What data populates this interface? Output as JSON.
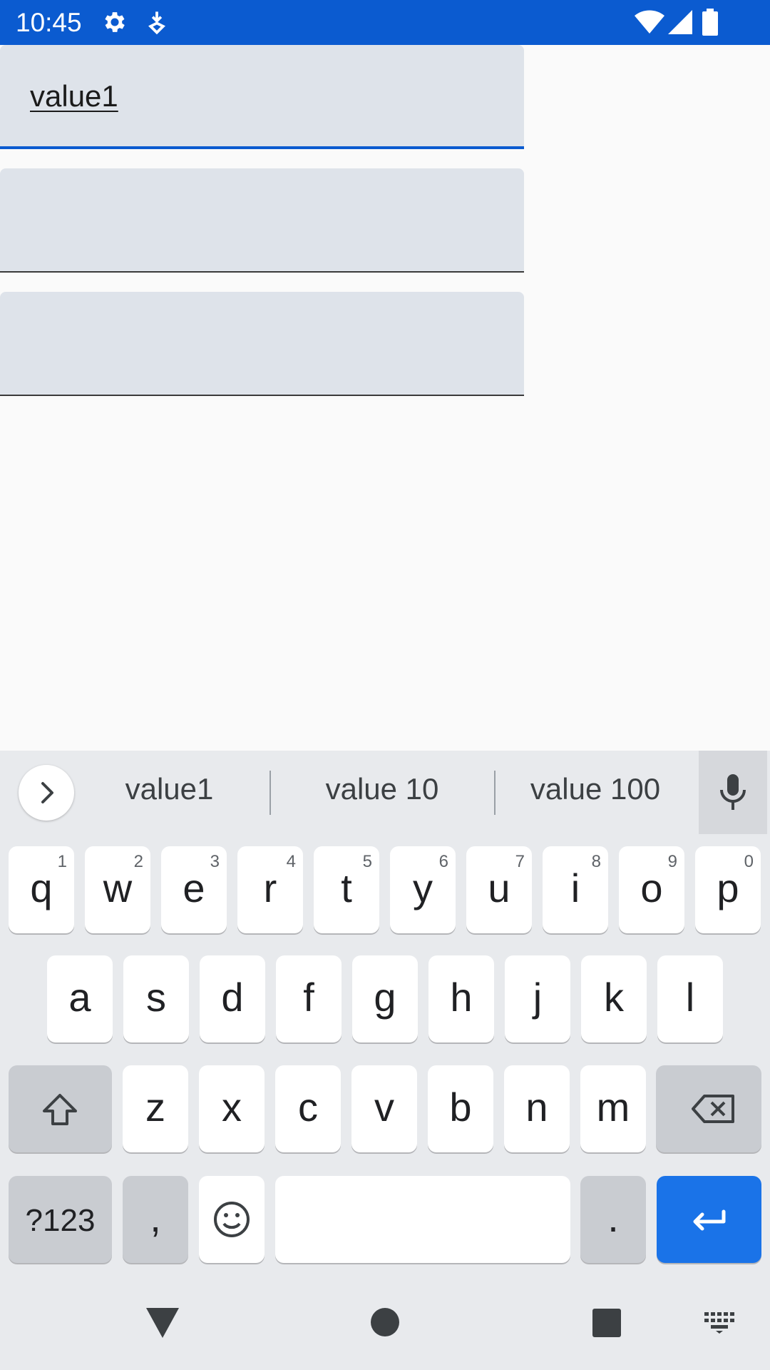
{
  "status_bar": {
    "time": "10:45",
    "icons": [
      "settings-icon",
      "download-icon",
      "wifi-icon",
      "cell-signal-icon",
      "battery-icon"
    ]
  },
  "fields": [
    {
      "value": "value1",
      "focused": true
    },
    {
      "value": "",
      "focused": false
    },
    {
      "value": "",
      "focused": false
    }
  ],
  "keyboard": {
    "suggestions": [
      "value1",
      "value 10",
      "value 100"
    ],
    "row1": [
      {
        "k": "q",
        "n": "1"
      },
      {
        "k": "w",
        "n": "2"
      },
      {
        "k": "e",
        "n": "3"
      },
      {
        "k": "r",
        "n": "4"
      },
      {
        "k": "t",
        "n": "5"
      },
      {
        "k": "y",
        "n": "6"
      },
      {
        "k": "u",
        "n": "7"
      },
      {
        "k": "i",
        "n": "8"
      },
      {
        "k": "o",
        "n": "9"
      },
      {
        "k": "p",
        "n": "0"
      }
    ],
    "row2": [
      "a",
      "s",
      "d",
      "f",
      "g",
      "h",
      "j",
      "k",
      "l"
    ],
    "row3": [
      "z",
      "x",
      "c",
      "v",
      "b",
      "n",
      "m"
    ],
    "symbols_label": "?123",
    "comma_label": ",",
    "period_label": "."
  },
  "colors": {
    "accent": "#0b5bd0",
    "enter_key": "#1a73e8",
    "field_bg": "#dee3ea"
  }
}
